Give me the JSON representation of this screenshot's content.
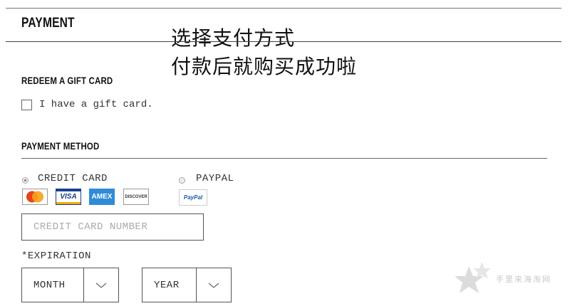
{
  "payment": {
    "heading": "PAYMENT"
  },
  "overlay_text": {
    "line1": "选择支付方式",
    "line2": "付款后就购买成功啦"
  },
  "gift_card": {
    "heading": "REDEEM A GIFT CARD",
    "checkbox_label": "I have a gift card.",
    "checked": false
  },
  "payment_method": {
    "heading": "PAYMENT METHOD",
    "options": [
      {
        "label": "CREDIT CARD",
        "selected": true
      },
      {
        "label": "PAYPAL",
        "selected": false
      }
    ],
    "card_logos": [
      {
        "name": "mastercard",
        "text": "MasterCard"
      },
      {
        "name": "visa",
        "text": "VISA"
      },
      {
        "name": "amex",
        "text": "AMEX"
      },
      {
        "name": "discover",
        "text": "DISCOVER"
      }
    ],
    "paypal_logo": "PayPal"
  },
  "card_number": {
    "placeholder": "CREDIT CARD NUMBER",
    "value": ""
  },
  "expiration": {
    "label": "*EXPIRATION",
    "month": {
      "selected": "MONTH"
    },
    "year": {
      "selected": "YEAR"
    }
  },
  "watermark": {
    "text": "手里来海淘网"
  },
  "colors": {
    "mastercard_red": "#e8431a",
    "mastercard_orange": "#f7a21b",
    "visa_blue": "#1a3f8f",
    "amex_blue": "#2f8bd7",
    "paypal_blue": "#1a5aa6"
  }
}
